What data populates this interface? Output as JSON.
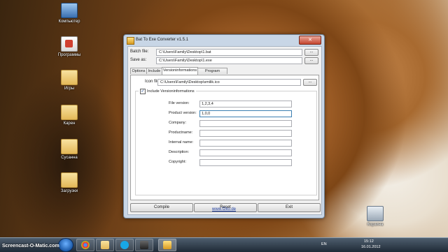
{
  "desktop": {
    "icons": [
      {
        "label": "Компьютер",
        "type": "computer"
      },
      {
        "label": "Программы",
        "type": "programs"
      },
      {
        "label": "Игры",
        "type": "folder"
      },
      {
        "label": "Карен",
        "type": "folder"
      },
      {
        "label": "Сусанна",
        "type": "folder"
      },
      {
        "label": "Загрузки",
        "type": "folder"
      },
      {
        "label": "Корзина",
        "type": "trash"
      }
    ]
  },
  "window": {
    "title": "Bat To Exe Converter v1.5.1",
    "close_glyph": "✕",
    "batch_file_label": "Batch file:",
    "batch_file_value": "C:\\Users\\Family\\Desktop\\1.bat",
    "save_as_label": "Save as:",
    "save_as_value": "C:\\Users\\Family\\Desktop\\1.exe",
    "browse_label": "...",
    "tabs": [
      "Options",
      "Include",
      "Versioninformations",
      "Program settings"
    ],
    "active_tab": "Versioninformations",
    "icon_file_label": "Icon file:",
    "icon_file_value": "C:\\Users\\Family\\Desktop\\smilik.ico",
    "include_version_label": "Include Versioninformations",
    "include_version_checked": "✓",
    "fields": [
      {
        "label": "File version:",
        "value": "1,2,3,4"
      },
      {
        "label": "Product version:",
        "value": "1,0,0"
      },
      {
        "label": "Company:",
        "value": ""
      },
      {
        "label": "Productname:",
        "value": ""
      },
      {
        "label": "Internal name:",
        "value": ""
      },
      {
        "label": "Description:",
        "value": ""
      },
      {
        "label": "Copyright:",
        "value": ""
      }
    ],
    "buttons": {
      "compile": "Compile",
      "reset": "Reset",
      "exit": "Exit"
    },
    "link": "www.f2ko.de"
  },
  "taskbar": {
    "watermark": "Screencast-O-Matic.com",
    "language": "EN",
    "time": "15:12",
    "date": "16.01.2012"
  },
  "colors": {
    "accent": "#1a3aa0",
    "close_button": "#c5452e"
  }
}
